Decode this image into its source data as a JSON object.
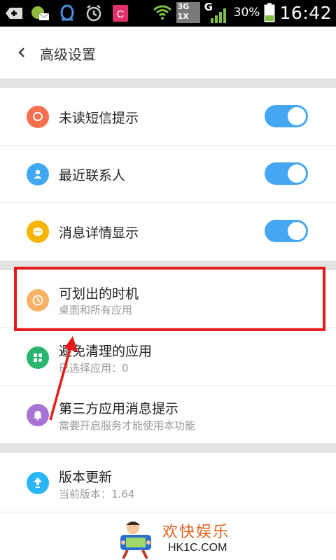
{
  "status_bar": {
    "network_3g": "3G",
    "network_1x": "1X",
    "network_g": "G",
    "battery": "30%",
    "time": "16:42"
  },
  "header": {
    "title": "高级设置"
  },
  "settings": {
    "unread_sms": {
      "title": "未读短信提示",
      "enabled": true,
      "icon": "chat-bubble-icon",
      "color": "#f4704f"
    },
    "recent_contacts": {
      "title": "最近联系人",
      "enabled": true,
      "icon": "person-icon",
      "color": "#42a7f2"
    },
    "message_detail": {
      "title": "消息详情显示",
      "enabled": true,
      "icon": "message-dots-icon",
      "color": "#f7b500"
    },
    "swipe_timing": {
      "title": "可划出的时机",
      "subtitle": "桌面和所有应用",
      "icon": "clock-icon",
      "color": "#f7b267"
    },
    "cleanup_exempt": {
      "title": "避免清理的应用",
      "subtitle": "已选择应用：0",
      "icon": "apps-grid-icon",
      "color": "#28b56e"
    },
    "third_party": {
      "title": "第三方应用消息提示",
      "subtitle": "需要开启服务才能使用本功能",
      "icon": "bell-icon",
      "color": "#a774d6"
    },
    "version": {
      "title": "版本更新",
      "subtitle": "当前版本：1.64",
      "icon": "upload-arrow-icon",
      "color": "#29b6f6"
    }
  },
  "watermark": {
    "cn": "欢快娱乐",
    "en": "HK1C.COM"
  },
  "colors": {
    "toggle_on": "#45a7f4",
    "highlight": "#e61a1a"
  }
}
